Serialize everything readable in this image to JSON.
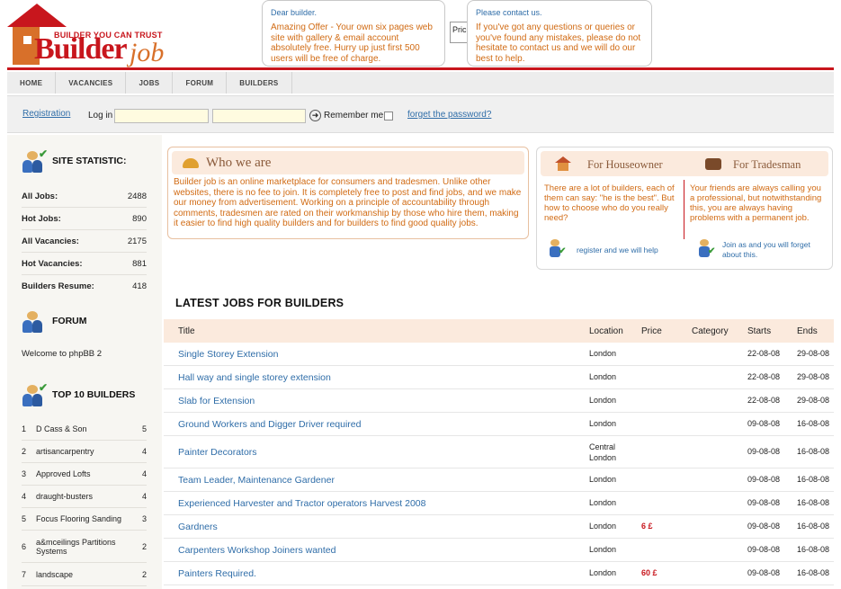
{
  "header": {
    "logo_tagline": "BUILDER YOU CAN TRUST",
    "logo_word1": "Builder",
    "logo_word2": "job",
    "offer_box": {
      "heading": "Dear builder.",
      "text": "Amazing Offer - Your own six pages web site with gallery & email account absolutely free. Hurry up just first 500 users will be free of charge."
    },
    "price_field": "Pric",
    "contact_box": {
      "heading": "Please contact us.",
      "text": "If you've got any questions or queries or you've found any mistakes, please do not hesitate to contact us and we will do our best to help."
    }
  },
  "nav": {
    "items": [
      "HOME",
      "VACANCIES",
      "JOBS",
      "FORUM",
      "BUILDERS"
    ]
  },
  "login": {
    "registration": "Registration",
    "login_label": "Log in",
    "go_icon": "arrow-right-circle",
    "remember": "Remember me",
    "forgot": "forget the password?"
  },
  "sidebar": {
    "statistic_title": "SITE STATISTIC:",
    "stats": [
      {
        "label": "All Jobs:",
        "value": "2488"
      },
      {
        "label": "Hot Jobs:",
        "value": "890"
      },
      {
        "label": "All Vacancies:",
        "value": "2175"
      },
      {
        "label": "Hot Vacancies:",
        "value": "881"
      },
      {
        "label": "Builders Resume:",
        "value": "418"
      }
    ],
    "forum_title": "FORUM",
    "forum_text": "Welcome to phpBB 2",
    "top_title": "TOP 10 BUILDERS",
    "top_builders": [
      {
        "rank": "1",
        "name": "D Cass & Son",
        "count": "5"
      },
      {
        "rank": "2",
        "name": "artisancarpentry",
        "count": "4"
      },
      {
        "rank": "3",
        "name": "Approved Lofts",
        "count": "4"
      },
      {
        "rank": "4",
        "name": "draught-busters",
        "count": "4"
      },
      {
        "rank": "5",
        "name": "Focus Flooring Sanding",
        "count": "3"
      },
      {
        "rank": "6",
        "name": "a&mceilings Partitions Systems",
        "count": "2"
      },
      {
        "rank": "7",
        "name": "landscape",
        "count": "2"
      }
    ]
  },
  "who": {
    "title": "Who we are",
    "text": "Builder job is an online marketplace for consumers and tradesmen. Unlike other websites, there is no fee to join. It is completely free to post and find jobs, and we make our money from advertisement. Working on a principle of accountability through comments, tradesmen are rated on their workmanship by those who hire them, making it easier to find high quality builders and for builders to find good quality jobs."
  },
  "audience": {
    "houseowner_title": "For Houseowner",
    "tradesman_title": "For Tradesman",
    "houseowner_text": "There are a lot of builders, each of them can say: \"he is the best\". But how to choose who do you really need?",
    "tradesman_text": "Your friends are always calling you a professional, but notwithstanding this, you are always having problems with a permanent job.",
    "houseowner_link": "register and we will help",
    "tradesman_link": "Join as and you will forget about this."
  },
  "jobs": {
    "heading": "LATEST JOBS FOR BUILDERS",
    "columns": {
      "title": "Title",
      "location": "Location",
      "price": "Price",
      "category": "Category",
      "starts": "Starts",
      "ends": "Ends"
    },
    "rows": [
      {
        "title": "Single Storey Extension",
        "location": "London",
        "price": "",
        "category": "",
        "starts": "22-08-08",
        "ends": "29-08-08"
      },
      {
        "title": "Hall way and single storey extension",
        "location": "London",
        "price": "",
        "category": "",
        "starts": "22-08-08",
        "ends": "29-08-08"
      },
      {
        "title": "Slab for Extension",
        "location": "London",
        "price": "",
        "category": "",
        "starts": "22-08-08",
        "ends": "29-08-08"
      },
      {
        "title": "Ground Workers and Digger Driver required",
        "location": "London",
        "price": "",
        "category": "",
        "starts": "09-08-08",
        "ends": "16-08-08"
      },
      {
        "title": "Painter Decorators",
        "location": "Central\nLondon",
        "price": "",
        "category": "",
        "starts": "09-08-08",
        "ends": "16-08-08"
      },
      {
        "title": "Team Leader, Maintenance Gardener",
        "location": "London",
        "price": "",
        "category": "",
        "starts": "09-08-08",
        "ends": "16-08-08"
      },
      {
        "title": "Experienced Harvester and Tractor operators Harvest 2008",
        "location": "London",
        "price": "",
        "category": "",
        "starts": "09-08-08",
        "ends": "16-08-08"
      },
      {
        "title": "Gardners",
        "location": "London",
        "price": "6 £",
        "category": "",
        "starts": "09-08-08",
        "ends": "16-08-08"
      },
      {
        "title": "Carpenters Workshop Joiners wanted",
        "location": "London",
        "price": "",
        "category": "",
        "starts": "09-08-08",
        "ends": "16-08-08"
      },
      {
        "title": "Painters Required.",
        "location": "London",
        "price": "60 £",
        "category": "",
        "starts": "09-08-08",
        "ends": "16-08-08"
      }
    ]
  },
  "colors": {
    "brand_red": "#c8161d",
    "orange_text": "#d16b14",
    "link_blue": "#2f6da8",
    "peach": "#fbeadd"
  }
}
